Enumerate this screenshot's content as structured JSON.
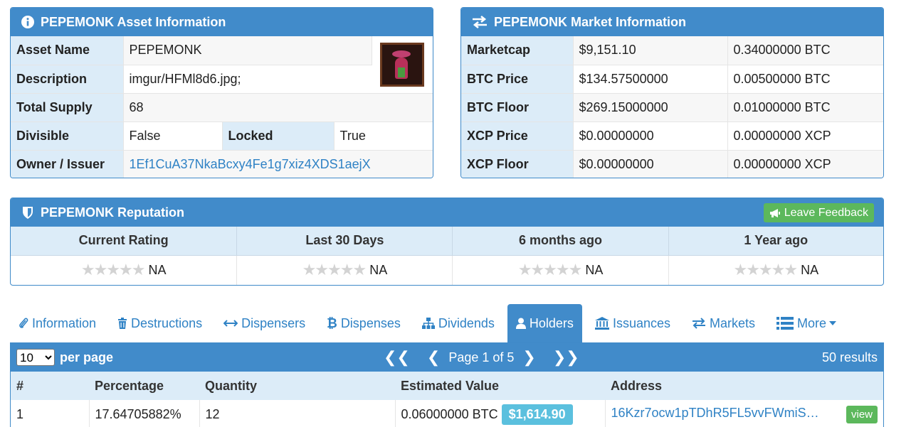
{
  "asset_panel": {
    "title": "PEPEMONK Asset Information",
    "rows": {
      "asset_name": {
        "label": "Asset Name",
        "value": "PEPEMONK"
      },
      "description": {
        "label": "Description",
        "value": "imgur/HFMl8d6.jpg;"
      },
      "total_supply": {
        "label": "Total Supply",
        "value": "68"
      },
      "divisible": {
        "label": "Divisible",
        "value": "False"
      },
      "locked": {
        "label": "Locked",
        "value": "True"
      },
      "owner": {
        "label": "Owner / Issuer",
        "value": "1Ef1CuA37NkaBcxy4Fe1g7xiz4XDS1aejX"
      }
    }
  },
  "market_panel": {
    "title": "PEPEMONK Market Information",
    "rows": [
      {
        "label": "Marketcap",
        "usd": "$9,151.10",
        "native": "0.34000000 BTC"
      },
      {
        "label": "BTC Price",
        "usd": "$134.57500000",
        "native": "0.00500000 BTC"
      },
      {
        "label": "BTC Floor",
        "usd": "$269.15000000",
        "native": "0.01000000 BTC"
      },
      {
        "label": "XCP Price",
        "usd": "$0.00000000",
        "native": "0.00000000 XCP"
      },
      {
        "label": "XCP Floor",
        "usd": "$0.00000000",
        "native": "0.00000000 XCP"
      }
    ]
  },
  "reputation_panel": {
    "title": "PEPEMONK Reputation",
    "feedback_label": "Leave Feedback",
    "columns": [
      {
        "header": "Current Rating",
        "value": "NA"
      },
      {
        "header": "Last 30 Days",
        "value": "NA"
      },
      {
        "header": "6 months ago",
        "value": "NA"
      },
      {
        "header": "1 Year ago",
        "value": "NA"
      }
    ],
    "star_glyphs": "★★★★★"
  },
  "tabs": [
    {
      "label": "Information",
      "icon": "paperclip-icon"
    },
    {
      "label": "Destructions",
      "icon": "trash-icon"
    },
    {
      "label": "Dispensers",
      "icon": "arrows-horizontal-icon"
    },
    {
      "label": "Dispenses",
      "icon": "bitcoin-icon"
    },
    {
      "label": "Dividends",
      "icon": "sitemap-icon"
    },
    {
      "label": "Holders",
      "icon": "user-icon"
    },
    {
      "label": "Issuances",
      "icon": "bank-icon"
    },
    {
      "label": "Markets",
      "icon": "exchange-icon"
    },
    {
      "label": "More",
      "icon": "list-icon"
    }
  ],
  "active_tab": "Holders",
  "holders": {
    "page_size": "10",
    "per_page_label": "per page",
    "first_label": "❮❮",
    "prev_label": "❮",
    "page_label": "Page 1 of 5",
    "next_label": "❯",
    "last_label": "❯❯",
    "results_label": "50 results",
    "headers": [
      "#",
      "Percentage",
      "Quantity",
      "Estimated Value",
      "Address"
    ],
    "rows": [
      {
        "rank": "1",
        "percentage": "17.64705882%",
        "quantity": "12",
        "btc_value": "0.06000000 BTC",
        "usd_value": "$1,614.90",
        "address": "16Kzr7ocw1pTDhR5FL5vvFWmiS…",
        "view_label": "view"
      }
    ]
  },
  "colors": {
    "primary": "#418bca",
    "label_bg": "#dcecf8",
    "success": "#5cb85c",
    "info": "#5bc0de",
    "link": "#2f82c5"
  }
}
